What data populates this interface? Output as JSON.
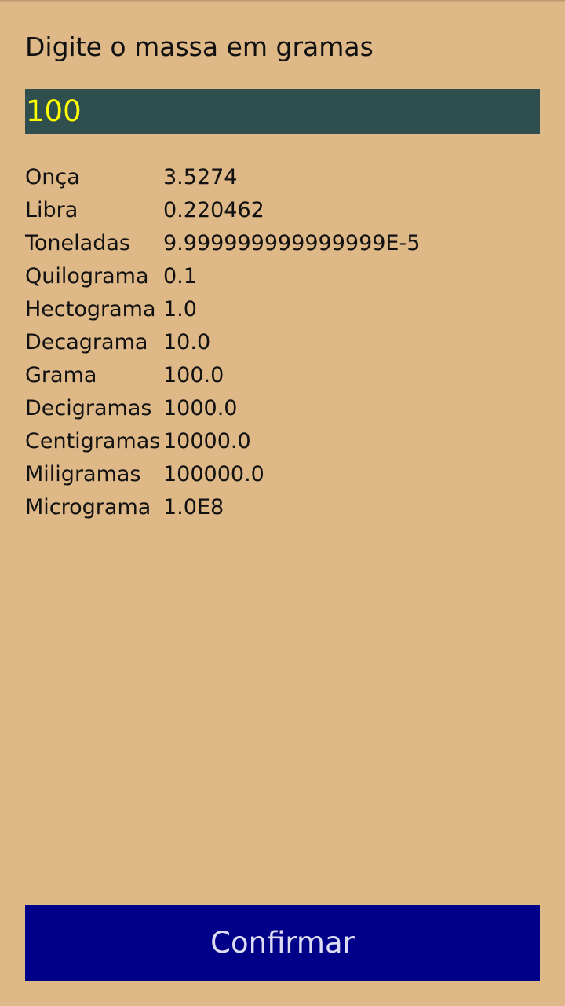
{
  "screen": {
    "prompt": "Digite o massa em gramas"
  },
  "input": {
    "value": "100"
  },
  "results": [
    {
      "unit": "Onça",
      "value": "3.5274"
    },
    {
      "unit": "Libra",
      "value": "0.220462"
    },
    {
      "unit": "Toneladas",
      "value": "9.999999999999999E-5"
    },
    {
      "unit": "Quilograma",
      "value": "0.1"
    },
    {
      "unit": "Hectograma",
      "value": "1.0"
    },
    {
      "unit": "Decagrama",
      "value": "10.0"
    },
    {
      "unit": "Grama",
      "value": "100.0"
    },
    {
      "unit": "Decigramas",
      "value": "1000.0"
    },
    {
      "unit": "Centigramas",
      "value": "10000.0"
    },
    {
      "unit": "Miligramas",
      "value": "100000.0"
    },
    {
      "unit": "Micrograma",
      "value": "1.0E8"
    }
  ],
  "button": {
    "label": "Confirmar"
  },
  "colors": {
    "background": "#deb887",
    "input_background": "#2f4f4f",
    "input_text": "#ffff00",
    "button_background": "#000088",
    "button_text": "#dcdcf2"
  }
}
